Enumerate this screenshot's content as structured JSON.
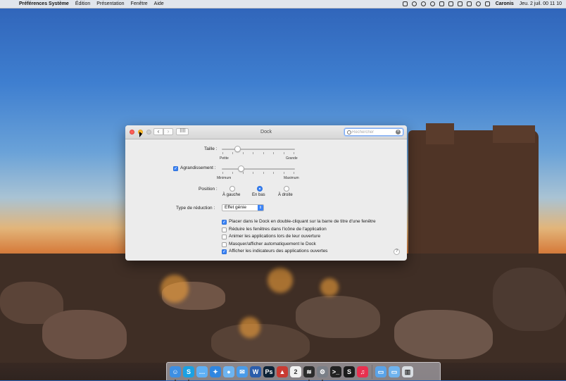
{
  "menubar": {
    "apple": "",
    "app_name": "Préférences Système",
    "menus": [
      "Édition",
      "Présentation",
      "Fenêtre",
      "Aide"
    ],
    "user": "Caronis",
    "clock": "Jeu. 2 juil.  00 11 10"
  },
  "window": {
    "title": "Dock",
    "search_placeholder": "Rechercher",
    "size": {
      "label": "Taille :",
      "min_label": "Petite",
      "max_label": "Grande",
      "value": 0.22
    },
    "magnification": {
      "label": "Agrandissement :",
      "checked": true,
      "min_label": "Minimum",
      "max_label": "Maximum",
      "value": 0.26
    },
    "position": {
      "label": "Position :",
      "options": [
        "À gauche",
        "En bas",
        "À droite"
      ],
      "selected": "En bas"
    },
    "minimize": {
      "label": "Type de réduction :",
      "value": "Effet génie"
    },
    "options": [
      {
        "label": "Placer dans le Dock en double-cliquant sur la barre de titre d'une fenêtre",
        "checked": true
      },
      {
        "label": "Réduire les fenêtres dans l'icône de l'application",
        "checked": false
      },
      {
        "label": "Animer les applications lors de leur ouverture",
        "checked": false
      },
      {
        "label": "Masquer/afficher automatiquement le Dock",
        "checked": false
      },
      {
        "label": "Afficher les indicateurs des applications ouvertes",
        "checked": true
      }
    ],
    "help": "?"
  },
  "dock": {
    "apps": [
      {
        "name": "finder-icon",
        "color": "#3d8fe3",
        "glyph": "☺",
        "running": true
      },
      {
        "name": "skype-icon",
        "color": "#1ba1e2",
        "glyph": "S",
        "running": true
      },
      {
        "name": "messages-icon",
        "color": "#5fb0f5",
        "glyph": "…",
        "running": false
      },
      {
        "name": "safari-icon",
        "color": "#2f86e0",
        "glyph": "✦",
        "running": false
      },
      {
        "name": "tweetbot-icon",
        "color": "#6db4f0",
        "glyph": "●",
        "running": false
      },
      {
        "name": "mail-icon",
        "color": "#4a9be8",
        "glyph": "✉",
        "running": false
      },
      {
        "name": "word-icon",
        "color": "#2b5dab",
        "glyph": "W",
        "running": false
      },
      {
        "name": "photoshop-icon",
        "color": "#0d2336",
        "glyph": "Ps",
        "running": false
      },
      {
        "name": "popcorn-icon",
        "color": "#c93b32",
        "glyph": "▲",
        "running": false
      },
      {
        "name": "calendar-icon",
        "color": "#f2f2f2",
        "glyph": "2",
        "running": false
      },
      {
        "name": "spotify-icon",
        "color": "#2c2c2c",
        "glyph": "≋",
        "running": true
      },
      {
        "name": "system-preferences-icon",
        "color": "#7a7f87",
        "glyph": "⚙",
        "running": true
      },
      {
        "name": "terminal-icon",
        "color": "#222222",
        "glyph": ">_",
        "running": false
      },
      {
        "name": "scrivener-icon",
        "color": "#1c1c1c",
        "glyph": "S",
        "running": false
      },
      {
        "name": "itunes-icon",
        "color": "#e8304f",
        "glyph": "♫",
        "running": false
      }
    ],
    "stacks": [
      {
        "name": "applications-folder-icon",
        "color": "#5aa3e8",
        "glyph": "▭"
      },
      {
        "name": "downloads-folder-icon",
        "color": "#6fb3ee",
        "glyph": "▭"
      },
      {
        "name": "trash-icon",
        "color": "#d8dde2",
        "glyph": "▥"
      }
    ]
  }
}
